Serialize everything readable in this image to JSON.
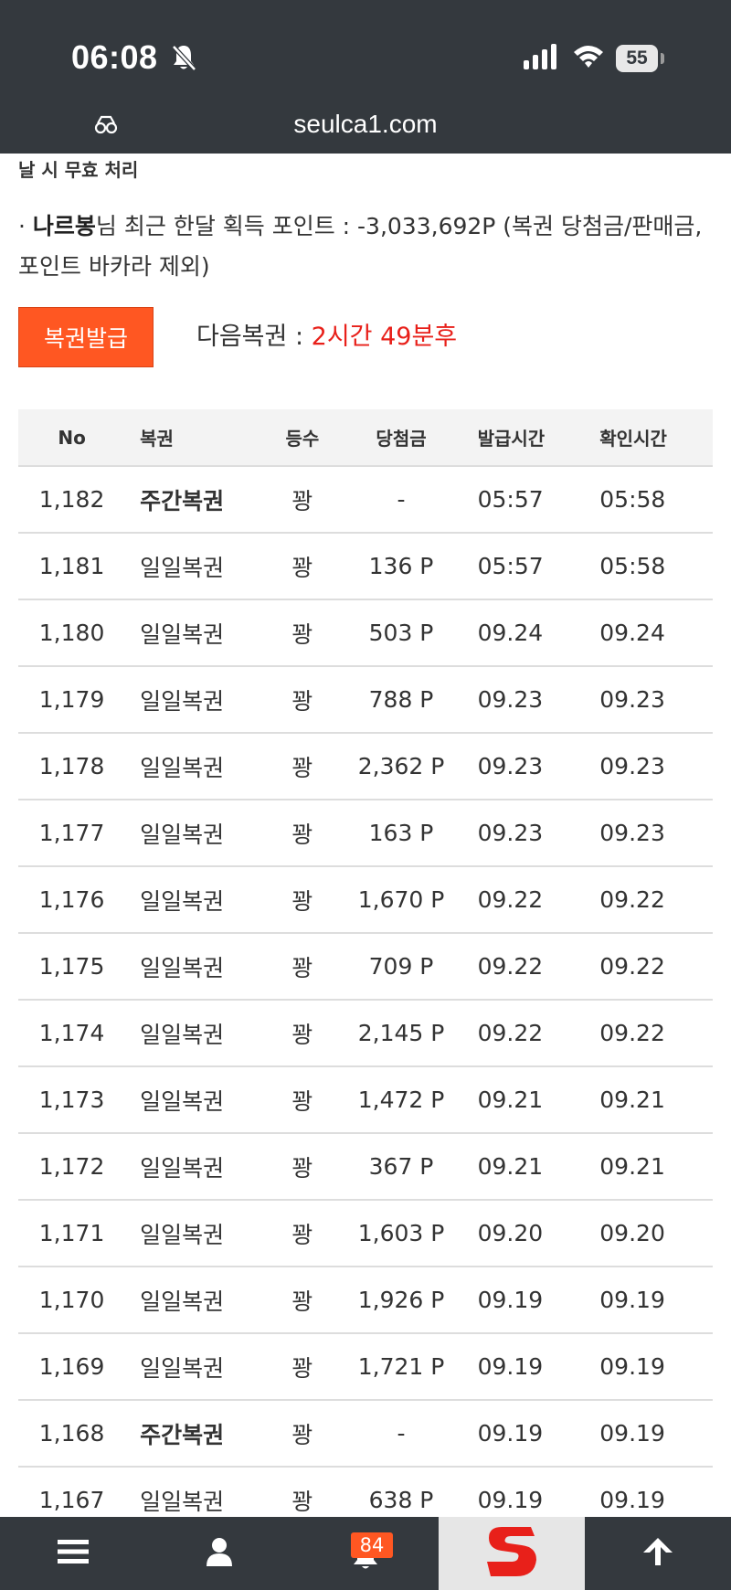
{
  "status_bar": {
    "time": "06:08",
    "battery": "55",
    "url": "seulca1.com"
  },
  "top_note": "날 시 무효 처리",
  "points": {
    "bullet": "·",
    "nickname": "나르봉",
    "prefix": "님 최근 한달 획득 포인트 : -3,033,692P (복권 당첨금/판매금, 포인트 바카라 제외)"
  },
  "issue_button": "복권발급",
  "next_lottery": {
    "label": "다음복권 :",
    "countdown": "2시간 49분후"
  },
  "table": {
    "headers": [
      "No",
      "복권",
      "등수",
      "당첨금",
      "발급시간",
      "확인시간"
    ],
    "rows": [
      {
        "no": "1,182",
        "type": "주간복권",
        "rank": "꽝",
        "prize": "-",
        "issued": "05:57",
        "checked": "05:58",
        "weekly": true
      },
      {
        "no": "1,181",
        "type": "일일복권",
        "rank": "꽝",
        "prize": "136 P",
        "issued": "05:57",
        "checked": "05:58",
        "weekly": false
      },
      {
        "no": "1,180",
        "type": "일일복권",
        "rank": "꽝",
        "prize": "503 P",
        "issued": "09.24",
        "checked": "09.24",
        "weekly": false
      },
      {
        "no": "1,179",
        "type": "일일복권",
        "rank": "꽝",
        "prize": "788 P",
        "issued": "09.23",
        "checked": "09.23",
        "weekly": false
      },
      {
        "no": "1,178",
        "type": "일일복권",
        "rank": "꽝",
        "prize": "2,362 P",
        "issued": "09.23",
        "checked": "09.23",
        "weekly": false
      },
      {
        "no": "1,177",
        "type": "일일복권",
        "rank": "꽝",
        "prize": "163 P",
        "issued": "09.23",
        "checked": "09.23",
        "weekly": false
      },
      {
        "no": "1,176",
        "type": "일일복권",
        "rank": "꽝",
        "prize": "1,670 P",
        "issued": "09.22",
        "checked": "09.22",
        "weekly": false
      },
      {
        "no": "1,175",
        "type": "일일복권",
        "rank": "꽝",
        "prize": "709 P",
        "issued": "09.22",
        "checked": "09.22",
        "weekly": false
      },
      {
        "no": "1,174",
        "type": "일일복권",
        "rank": "꽝",
        "prize": "2,145 P",
        "issued": "09.22",
        "checked": "09.22",
        "weekly": false
      },
      {
        "no": "1,173",
        "type": "일일복권",
        "rank": "꽝",
        "prize": "1,472 P",
        "issued": "09.21",
        "checked": "09.21",
        "weekly": false
      },
      {
        "no": "1,172",
        "type": "일일복권",
        "rank": "꽝",
        "prize": "367 P",
        "issued": "09.21",
        "checked": "09.21",
        "weekly": false
      },
      {
        "no": "1,171",
        "type": "일일복권",
        "rank": "꽝",
        "prize": "1,603 P",
        "issued": "09.20",
        "checked": "09.20",
        "weekly": false
      },
      {
        "no": "1,170",
        "type": "일일복권",
        "rank": "꽝",
        "prize": "1,926 P",
        "issued": "09.19",
        "checked": "09.19",
        "weekly": false
      },
      {
        "no": "1,169",
        "type": "일일복권",
        "rank": "꽝",
        "prize": "1,721 P",
        "issued": "09.19",
        "checked": "09.19",
        "weekly": false
      },
      {
        "no": "1,168",
        "type": "주간복권",
        "rank": "꽝",
        "prize": "-",
        "issued": "09.19",
        "checked": "09.19",
        "weekly": true
      },
      {
        "no": "1,167",
        "type": "일일복권",
        "rank": "꽝",
        "prize": "638 P",
        "issued": "09.19",
        "checked": "09.19",
        "weekly": false
      }
    ]
  },
  "bottom_nav": {
    "notification_count": "84",
    "icons": [
      "menu-icon",
      "user-icon",
      "bell-icon",
      "site-logo",
      "arrow-up-icon"
    ]
  },
  "colors": {
    "header_bg": "#34393e",
    "accent": "#ff5722",
    "countdown": "#e8201a",
    "logo_red": "#e8201a"
  }
}
